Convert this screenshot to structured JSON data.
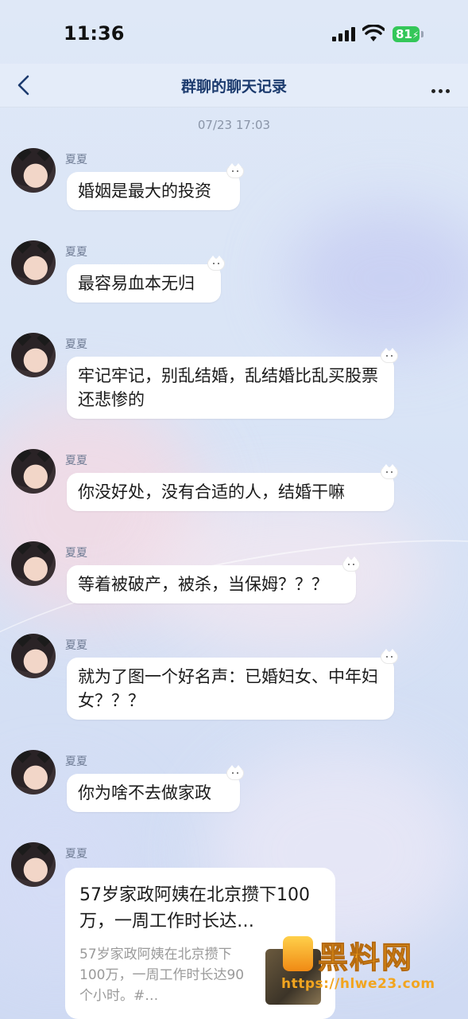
{
  "status_bar": {
    "time": "11:36",
    "battery": "81"
  },
  "nav": {
    "title": "群聊的聊天记录",
    "back_icon": "chevron-left-icon",
    "more_icon": "ellipsis-icon"
  },
  "timestamp": "07/23 17:03",
  "messages": [
    {
      "sender": "夏夏",
      "text": "婚姻是最大的投资"
    },
    {
      "sender": "夏夏",
      "text": "最容易血本无归"
    },
    {
      "sender": "夏夏",
      "text": "牢记牢记，别乱结婚，乱结婚比乱买股票还悲惨的"
    },
    {
      "sender": "夏夏",
      "text": "你没好处，没有合适的人，结婚干嘛"
    },
    {
      "sender": "夏夏",
      "text": "等着被破产，被杀，当保姆？？？"
    },
    {
      "sender": "夏夏",
      "text": "就为了图一个好名声：已婚妇女、中年妇女？？？"
    },
    {
      "sender": "夏夏",
      "text": "你为啥不去做家政"
    },
    {
      "sender": "夏夏"
    }
  ],
  "card": {
    "title": "57岁家政阿姨在北京攒下100万，一周工作时长达…",
    "description": "57岁家政阿姨在北京攒下100万，一周工作时长达90个小时。#…"
  },
  "watermark": {
    "text": "黑料网",
    "url": "https://hlwe23.com"
  }
}
